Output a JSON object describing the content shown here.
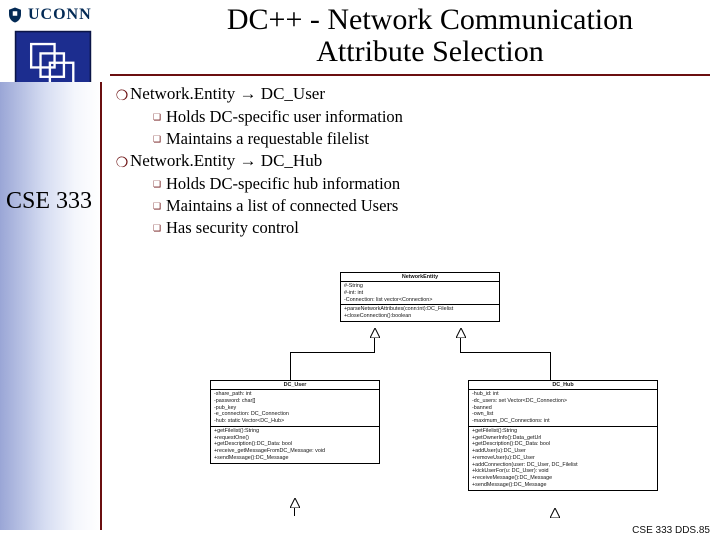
{
  "title_line1": "DC++ - Network Communication",
  "title_line2": "Attribute Selection",
  "uconn": "UCONN",
  "course": "CSE 333",
  "b1a_pre": "Network.Entity ",
  "b1a_arrow": "→",
  "b1a_post": " DC_User",
  "b2a1": "Holds DC-specific user information",
  "b2a2": "Maintains a requestable filelist",
  "b1b_pre": "Network.Entity ",
  "b1b_arrow": "→",
  "b1b_post": " DC_Hub",
  "b2b1": "Holds DC-specific hub information",
  "b2b2": "Maintains a list of connected Users",
  "b2b3": "Has security control",
  "uml": {
    "ne": {
      "title": "NetworkEntity",
      "attrs": "#-String\n#-int: int\n-Connection: list vector<Connection>",
      "ops": "+parseNetworkAttributes(conn:int):DC_Filelist\n+closeConnection():boolean"
    },
    "user": {
      "title": "DC_User",
      "attrs": "-share_path: int\n-password: char[]\n-pub_key\n-e_connection: DC_Connection\n-hub: static Vector<DC_Hub>",
      "ops": "+getFilelist():String\n+requestOne()\n+getDescription():DC_Data: bool\n+receive_getMessageFromDC_Message: void\n+sendMessage():DC_Message"
    },
    "hub": {
      "title": "DC_Hub",
      "attrs": "-hub_id: int\n-dc_users: set Vector<DC_Connection>\n-banned\n-own_list\n-maximum_DC_Connections: int",
      "ops": "+getFilelist():String\n+getOwnerInfo():Data_getUrl\n+getDescription():DC_Data: bool\n+addUser(u):DC_User\n+removeUser(u):DC_User\n+addConnection(user: DC_User, DC_Filelist\n+kickUserFor(u: DC_User): void\n+receiveMessage():DC_Message\n+sendMessage():DC_Message"
    }
  },
  "footer": "CSE 333  DDS.85"
}
